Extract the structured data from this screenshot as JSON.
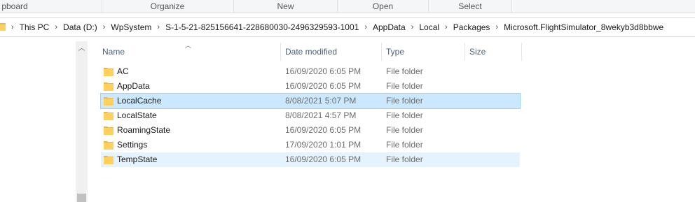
{
  "ribbon": {
    "groups": [
      "pboard",
      "Organize",
      "New",
      "Open",
      "Select"
    ]
  },
  "address": {
    "crumbs": [
      "This PC",
      "Data (D:)",
      "WpSystem",
      "S-1-5-21-825156641-228680030-2496329593-1001",
      "AppData",
      "Local",
      "Packages",
      "Microsoft.FlightSimulator_8wekyb3d8bbwe"
    ]
  },
  "columns": {
    "name": "Name",
    "date": "Date modified",
    "type": "Type",
    "size": "Size"
  },
  "files": [
    {
      "name": "AC",
      "date": "16/09/2020 6:05 PM",
      "type": "File folder",
      "state": "normal"
    },
    {
      "name": "AppData",
      "date": "16/09/2020 6:05 PM",
      "type": "File folder",
      "state": "normal"
    },
    {
      "name": "LocalCache",
      "date": "8/08/2021 5:07 PM",
      "type": "File folder",
      "state": "selected"
    },
    {
      "name": "LocalState",
      "date": "8/08/2021 4:57 PM",
      "type": "File folder",
      "state": "normal"
    },
    {
      "name": "RoamingState",
      "date": "16/09/2020 6:05 PM",
      "type": "File folder",
      "state": "normal"
    },
    {
      "name": "Settings",
      "date": "17/09/2020 1:01 PM",
      "type": "File folder",
      "state": "normal"
    },
    {
      "name": "TempState",
      "date": "16/09/2020 6:05 PM",
      "type": "File folder",
      "state": "hover"
    }
  ],
  "colors": {
    "selected_bg": "#cce8ff",
    "selected_border": "#99d1ff",
    "hover_bg": "#e5f3ff",
    "folder_yellow": "#ffd15c"
  },
  "icons": {
    "folder": "folder-icon",
    "chevron": "chevron-right-icon",
    "sort": "sort-ascending-icon",
    "scroll_up": "scroll-up-icon"
  }
}
